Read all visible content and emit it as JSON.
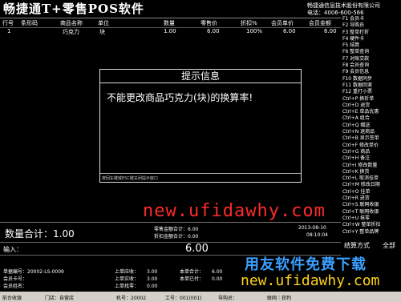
{
  "header": {
    "title": "畅捷通T+零售POS软件",
    "company": "畅捷通信息技术股份有限公司",
    "phone": "电话：4006-600-566"
  },
  "table": {
    "columns": [
      "行号",
      "条形码",
      "商品名称",
      "单位",
      "数量",
      "零售价",
      "折扣%",
      "会员单价",
      "会员金额"
    ],
    "rows": [
      [
        "1",
        "",
        "巧克力",
        "块",
        "1.00",
        "6.00",
        "100%",
        "6.00",
        "6.00"
      ]
    ]
  },
  "side_menu": [
    "F1 会员卡",
    "F2 导购员",
    "F3 整单打折",
    "F4 硬件卡",
    "F5 结算",
    "F6 整单查询",
    "F7 对账交款",
    "F8 会员查询",
    "F9 会员信息",
    "F10 数据同步",
    "F11 数据回滚",
    "F12 重打小票",
    "Ctrl+P 换折单",
    "Ctrl+D 退货",
    "Ctrl+E 单品优惠",
    "Ctrl+A 组合",
    "Ctrl+Q 赠送",
    "Ctrl+N 退商品",
    "Ctrl+B 显示签单",
    "Ctrl+F 修改单价",
    "Ctrl+G 商品",
    "Ctrl+H 备注",
    "Ctrl+I 修改数量",
    "Ctrl+K 换货",
    "Ctrl+L 取消挂单",
    "Ctrl+M 修改日期",
    "Ctrl+O 挂单",
    "Ctrl+R 进货",
    "Ctrl+S 联网收银",
    "Ctrl+T 联网收银",
    "Ctrl+U 抹零",
    "Ctrl+W 整单折扣",
    "Ctrl+Y 整单品牌"
  ],
  "dialog": {
    "title": "提示信息",
    "message": "不能更改商品巧克力(块)的换算率!",
    "hint": "按回车键或ESC键关闭提示窗口"
  },
  "watermarks": {
    "red": "new.ufidawhy.com",
    "blue": "用友软件免费下载",
    "yellow": "new.ufidawhy.com"
  },
  "totals": {
    "qty_label": "数量合计：",
    "qty_value": "1.00",
    "retail_total_label": "零售金额合计：",
    "retail_total_value": "6.00",
    "discount_total_label": "折扣金额合计：",
    "discount_total_value": "0.00",
    "date": "2013-08-10",
    "time": "08:10:04"
  },
  "input": {
    "label": "输入：",
    "value": "6.00"
  },
  "side_buttons": {
    "settle": "结算方式",
    "all": "全部"
  },
  "bottom": {
    "doc_no_label": "单据编号：",
    "doc_no_value": "20002-LS-0009",
    "member_card_label": "会员卡号：",
    "member_name_label": "会员姓名：",
    "prev_receivable_label": "上单应收：",
    "prev_receivable_value": "3.00",
    "prev_received_label": "上单实收：",
    "prev_received_value": "3.00",
    "prev_change_label": "上单找零：",
    "prev_change_value": "0.00",
    "this_receivable_label": "本单合计：",
    "this_receivable_value": "6.00",
    "this_paid_label": "本单已付：",
    "this_paid_value": "0.00"
  },
  "status_bar": {
    "cashier": "前台收银",
    "store": "门店：自营店",
    "machine": "机号：20002",
    "staff": "工号：001(001)",
    "guide": "导购员：",
    "mode": "联网｜获判"
  },
  "colors": {
    "background": "#000000",
    "watermark_red": "#ff2a2a",
    "watermark_blue": "#3aa0ff",
    "watermark_yellow": "#ffd21f",
    "status_bar": "#d4d0c8"
  }
}
